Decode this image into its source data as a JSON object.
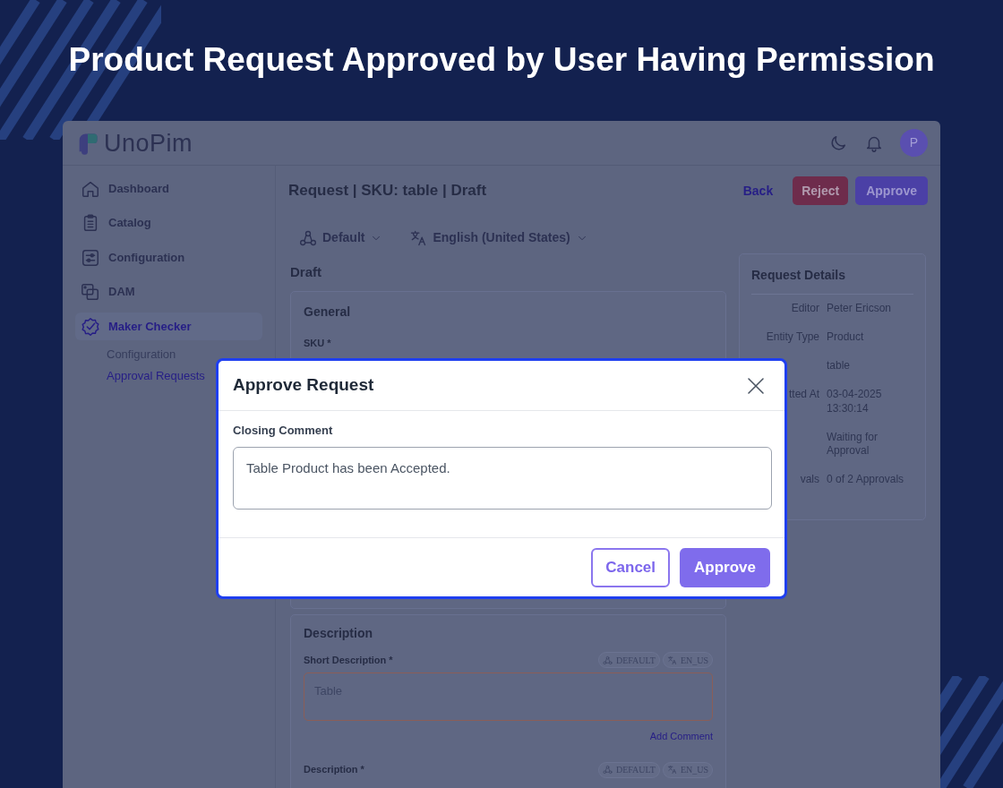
{
  "banner": {
    "title": "Product Request Approved by User Having Permission"
  },
  "app": {
    "logo": "UnoPim",
    "avatar": "P"
  },
  "sidebar": {
    "items": [
      {
        "label": "Dashboard",
        "selected": false
      },
      {
        "label": "Catalog",
        "selected": false
      },
      {
        "label": "Configuration",
        "selected": false
      },
      {
        "label": "DAM",
        "selected": false
      },
      {
        "label": "Maker Checker",
        "selected": true,
        "children": [
          {
            "label": "Configuration",
            "selected": false
          },
          {
            "label": "Approval Requests",
            "selected": true
          }
        ]
      }
    ]
  },
  "page": {
    "title": "Request | SKU: table | Draft",
    "actions": [
      {
        "label": "Back",
        "kind": "link"
      },
      {
        "label": "Reject",
        "kind": "danger"
      },
      {
        "label": "Approve",
        "kind": "primary"
      }
    ],
    "channel": "Default",
    "locale": "English (United States)",
    "section": "Draft"
  },
  "general": {
    "title": "General",
    "fields": [
      {
        "label": "SKU *"
      }
    ]
  },
  "description": {
    "title": "Description",
    "fields": [
      {
        "label": "Short Description *",
        "channel": "DEFAULT",
        "locale": "EN_US",
        "value": "Table",
        "action": "Add Comment"
      },
      {
        "label": "Description *",
        "channel": "DEFAULT",
        "locale": "EN_US"
      }
    ]
  },
  "request_details": {
    "title": "Request Details",
    "rows": [
      {
        "label": "Editor",
        "value": "Peter Ericson"
      },
      {
        "label": "Entity Type",
        "value": "Product"
      },
      {
        "value": "table"
      },
      {
        "label": "tted At",
        "value": "03-04-2025 13:30:14"
      },
      {
        "value": "Waiting for Approval"
      },
      {
        "label": "vals",
        "value": "0 of 2 Approvals"
      }
    ]
  },
  "modal": {
    "title": "Approve Request",
    "field_label": "Closing Comment",
    "value": "Table Product has been Accepted.",
    "buttons": [
      {
        "label": "Cancel",
        "kind": "secondary"
      },
      {
        "label": "Approve",
        "kind": "primary"
      }
    ]
  }
}
